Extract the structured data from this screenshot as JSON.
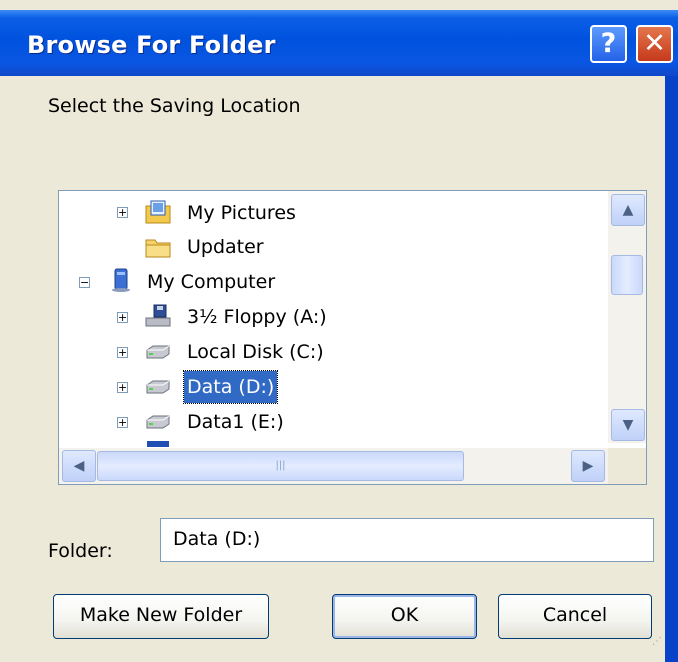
{
  "window": {
    "title": "Browse For Folder",
    "help_glyph": "?",
    "close_glyph": "✕"
  },
  "instruction": "Select the Saving Location",
  "tree": {
    "items": [
      {
        "label": "My Pictures",
        "expander": "+",
        "icon": "pictures-folder-icon"
      },
      {
        "label": "Updater",
        "expander": "",
        "icon": "folder-icon"
      },
      {
        "label": "My Computer",
        "expander": "−",
        "icon": "computer-icon"
      },
      {
        "label": "3½ Floppy (A:)",
        "expander": "+",
        "icon": "floppy-drive-icon"
      },
      {
        "label": "Local Disk (C:)",
        "expander": "+",
        "icon": "hard-disk-icon"
      },
      {
        "label": "Data (D:)",
        "expander": "+",
        "icon": "hard-disk-icon",
        "selected": true
      },
      {
        "label": "Data1 (E:)",
        "expander": "+",
        "icon": "hard-disk-icon"
      }
    ]
  },
  "folder": {
    "label": "Folder:",
    "value": "Data (D:)"
  },
  "buttons": {
    "make_new_folder": "Make New Folder",
    "ok": "OK",
    "cancel": "Cancel"
  },
  "colors": {
    "title_bar": "#0052de",
    "selection": "#316ac5",
    "dialog_bg": "#ece9d8"
  }
}
